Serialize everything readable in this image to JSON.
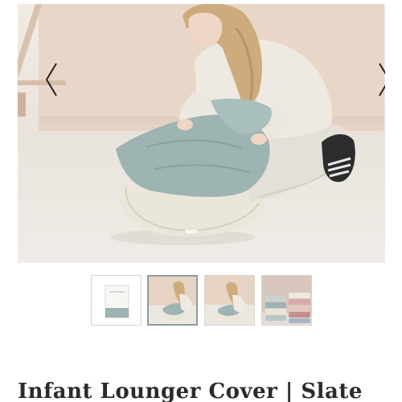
{
  "gallery": {
    "main_image_alt": "Woman kneeling on floor placing a slate blue cover onto a cream infant lounger",
    "prev_icon": "chevron-left-icon",
    "next_icon": "chevron-right-icon",
    "thumbnails": [
      {
        "name": "thumbnail-packaged-cover",
        "selected": false
      },
      {
        "name": "thumbnail-woman-with-lounger",
        "selected": true
      },
      {
        "name": "thumbnail-woman-with-lounger-alt",
        "selected": false
      },
      {
        "name": "thumbnail-stacked-covers",
        "selected": false
      }
    ]
  },
  "product": {
    "title": "Infant Lounger Cover | Slate"
  },
  "colors": {
    "slate": "#9db4b2",
    "cream": "#ece7dc",
    "text": "#2b2b2b",
    "thumb_border_active": "#8b9ba0"
  }
}
